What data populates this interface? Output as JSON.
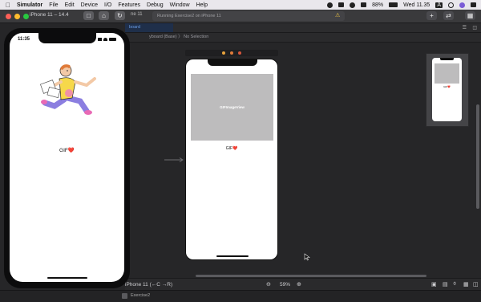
{
  "menubar": {
    "apple": "",
    "app_name": "Simulator",
    "items": [
      "File",
      "Edit",
      "Device",
      "I/O",
      "Features",
      "Debug",
      "Window",
      "Help"
    ],
    "battery": "88%",
    "clock": "Wed 11.35",
    "input_source": "A"
  },
  "toolbar": {
    "window_title": "iPhone 11 – 14.4",
    "scheme_partial": "ne 11",
    "status_text": "Running Exercise2 on iPhone 11",
    "warning_icon": "warning-icon"
  },
  "editor": {
    "tab_label": "board",
    "breadcrumb": "yboard (Base)  〉 No Selection",
    "device_label": "iPhone 11 (←C →R)",
    "zoom": "59%",
    "bottom_tab": "Exercise2"
  },
  "storyboard": {
    "image_placeholder": "GIFImageView",
    "label_text": "GIF❤️"
  },
  "simulator": {
    "time": "11:35",
    "label_text": "GIF❤️"
  },
  "colors": {
    "accent": "#0a84ff",
    "menubar_bg": "#e9e7ec",
    "editor_bg": "#262628",
    "close": "#ff5f57",
    "minimize": "#febc2e",
    "zoom": "#28c840"
  }
}
